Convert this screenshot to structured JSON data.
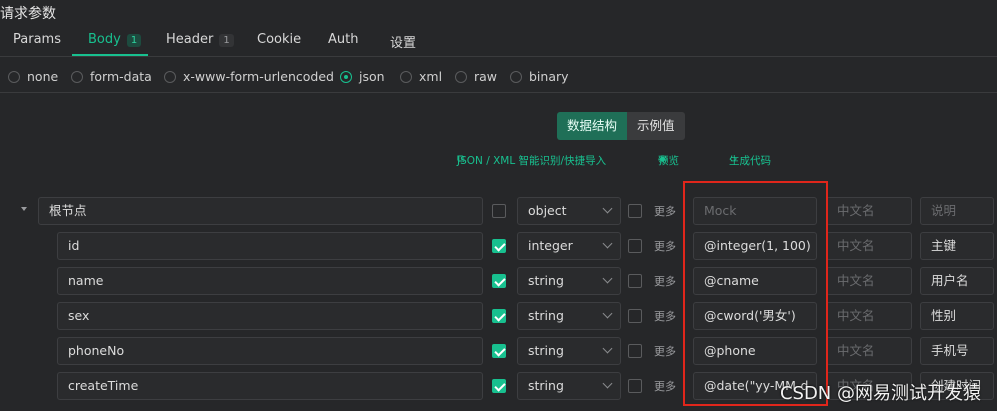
{
  "title": "请求参数",
  "tabs": [
    {
      "label": "Params"
    },
    {
      "label": "Body",
      "badge": "1"
    },
    {
      "label": "Header",
      "badge": "1"
    },
    {
      "label": "Cookie"
    },
    {
      "label": "Auth"
    },
    {
      "label": "设置"
    }
  ],
  "body_types": [
    "none",
    "form-data",
    "x-www-form-urlencoded",
    "json",
    "xml",
    "raw",
    "binary"
  ],
  "selected_body_type": "json",
  "segment": {
    "structure": "数据结构",
    "example": "示例值"
  },
  "links": {
    "import": "JSON / XML 智能识别/快捷导入",
    "preview": "预览",
    "gen_code": "生成代码"
  },
  "placeholders": {
    "mock": "Mock",
    "cn_name": "中文名",
    "desc": "说明"
  },
  "more_label": "更多",
  "rows": [
    {
      "name": "根节点",
      "type": "object",
      "required": false,
      "mock": "",
      "cn_name": "",
      "desc": ""
    },
    {
      "name": "id",
      "type": "integer",
      "required": true,
      "mock": "@integer(1, 100)",
      "cn_name": "",
      "desc": "主键"
    },
    {
      "name": "name",
      "type": "string",
      "required": true,
      "mock": "@cname",
      "cn_name": "",
      "desc": "用户名"
    },
    {
      "name": "sex",
      "type": "string",
      "required": true,
      "mock": "@cword('男女')",
      "cn_name": "",
      "desc": "性别"
    },
    {
      "name": "phoneNo",
      "type": "string",
      "required": true,
      "mock": "@phone",
      "cn_name": "",
      "desc": "手机号"
    },
    {
      "name": "createTime",
      "type": "string",
      "required": true,
      "mock": "@date(\"yy-MM-d",
      "cn_name": "",
      "desc": "创建时间"
    }
  ],
  "watermark": "CSDN @网易测试开发猿",
  "colors": {
    "accent": "#18c08f",
    "highlight_box": "#e0261b",
    "background": "#262729"
  }
}
